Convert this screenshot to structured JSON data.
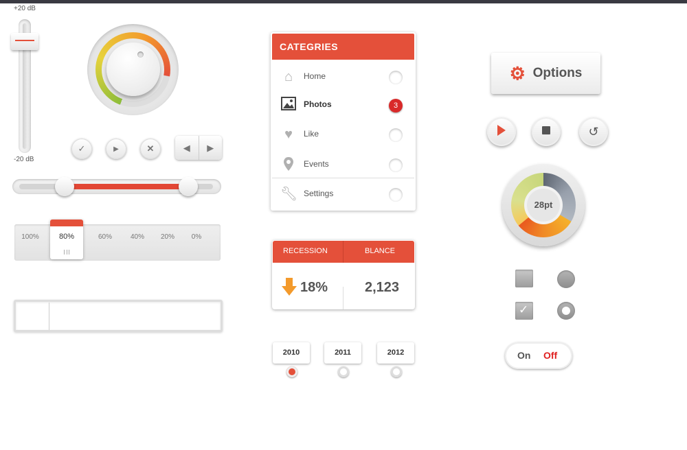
{
  "volume": {
    "max_label": "+20 dB",
    "min_label": "-20 dB",
    "level": 0.9
  },
  "knob": {
    "level": 0.72
  },
  "small_buttons": {
    "check_icon": "check-icon",
    "play_icon": "play-icon",
    "close_icon": "close-icon",
    "prev_icon": "left-arrow-icon",
    "next_icon": "right-arrow-icon"
  },
  "range_slider": {
    "low": 0.25,
    "high": 0.84
  },
  "percent_selector": {
    "options": [
      "100%",
      "80%",
      "60%",
      "40%",
      "20%",
      "0%"
    ],
    "selected": "80%"
  },
  "categories": {
    "title": "CATEGRIES",
    "items": [
      {
        "label": "Home",
        "icon": "home-icon",
        "badge": null
      },
      {
        "label": "Photos",
        "icon": "image-icon",
        "badge": "3"
      },
      {
        "label": "Like",
        "icon": "heart-icon",
        "badge": null
      },
      {
        "label": "Events",
        "icon": "location-pin-icon",
        "badge": null
      },
      {
        "label": "Settings",
        "icon": "wrench-icon",
        "badge": null
      }
    ]
  },
  "stats": {
    "col1_label": "RECESSION",
    "col2_label": "BLANCE",
    "col1_value": "18%",
    "col2_value": "2,123"
  },
  "timeline": {
    "years": [
      "2010",
      "2011",
      "2012"
    ],
    "active": "2010"
  },
  "options_button": {
    "label": "Options"
  },
  "gauge": {
    "value": "28pt"
  },
  "toggle": {
    "on_label": "On",
    "off_label": "Off",
    "state": "Off"
  },
  "colors": {
    "accent": "#e4503a",
    "badge": "#d92a2a"
  }
}
